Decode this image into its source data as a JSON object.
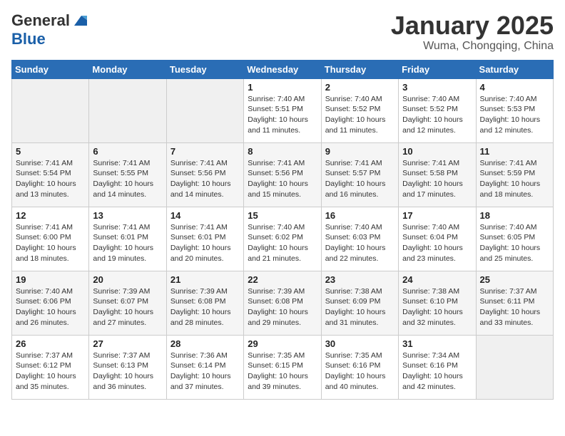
{
  "logo": {
    "general": "General",
    "blue": "Blue"
  },
  "title": "January 2025",
  "location": "Wuma, Chongqing, China",
  "days_of_week": [
    "Sunday",
    "Monday",
    "Tuesday",
    "Wednesday",
    "Thursday",
    "Friday",
    "Saturday"
  ],
  "weeks": [
    [
      {
        "day": "",
        "info": ""
      },
      {
        "day": "",
        "info": ""
      },
      {
        "day": "",
        "info": ""
      },
      {
        "day": "1",
        "info": "Sunrise: 7:40 AM\nSunset: 5:51 PM\nDaylight: 10 hours\nand 11 minutes."
      },
      {
        "day": "2",
        "info": "Sunrise: 7:40 AM\nSunset: 5:52 PM\nDaylight: 10 hours\nand 11 minutes."
      },
      {
        "day": "3",
        "info": "Sunrise: 7:40 AM\nSunset: 5:52 PM\nDaylight: 10 hours\nand 12 minutes."
      },
      {
        "day": "4",
        "info": "Sunrise: 7:40 AM\nSunset: 5:53 PM\nDaylight: 10 hours\nand 12 minutes."
      }
    ],
    [
      {
        "day": "5",
        "info": "Sunrise: 7:41 AM\nSunset: 5:54 PM\nDaylight: 10 hours\nand 13 minutes."
      },
      {
        "day": "6",
        "info": "Sunrise: 7:41 AM\nSunset: 5:55 PM\nDaylight: 10 hours\nand 14 minutes."
      },
      {
        "day": "7",
        "info": "Sunrise: 7:41 AM\nSunset: 5:56 PM\nDaylight: 10 hours\nand 14 minutes."
      },
      {
        "day": "8",
        "info": "Sunrise: 7:41 AM\nSunset: 5:56 PM\nDaylight: 10 hours\nand 15 minutes."
      },
      {
        "day": "9",
        "info": "Sunrise: 7:41 AM\nSunset: 5:57 PM\nDaylight: 10 hours\nand 16 minutes."
      },
      {
        "day": "10",
        "info": "Sunrise: 7:41 AM\nSunset: 5:58 PM\nDaylight: 10 hours\nand 17 minutes."
      },
      {
        "day": "11",
        "info": "Sunrise: 7:41 AM\nSunset: 5:59 PM\nDaylight: 10 hours\nand 18 minutes."
      }
    ],
    [
      {
        "day": "12",
        "info": "Sunrise: 7:41 AM\nSunset: 6:00 PM\nDaylight: 10 hours\nand 18 minutes."
      },
      {
        "day": "13",
        "info": "Sunrise: 7:41 AM\nSunset: 6:01 PM\nDaylight: 10 hours\nand 19 minutes."
      },
      {
        "day": "14",
        "info": "Sunrise: 7:41 AM\nSunset: 6:01 PM\nDaylight: 10 hours\nand 20 minutes."
      },
      {
        "day": "15",
        "info": "Sunrise: 7:40 AM\nSunset: 6:02 PM\nDaylight: 10 hours\nand 21 minutes."
      },
      {
        "day": "16",
        "info": "Sunrise: 7:40 AM\nSunset: 6:03 PM\nDaylight: 10 hours\nand 22 minutes."
      },
      {
        "day": "17",
        "info": "Sunrise: 7:40 AM\nSunset: 6:04 PM\nDaylight: 10 hours\nand 23 minutes."
      },
      {
        "day": "18",
        "info": "Sunrise: 7:40 AM\nSunset: 6:05 PM\nDaylight: 10 hours\nand 25 minutes."
      }
    ],
    [
      {
        "day": "19",
        "info": "Sunrise: 7:40 AM\nSunset: 6:06 PM\nDaylight: 10 hours\nand 26 minutes."
      },
      {
        "day": "20",
        "info": "Sunrise: 7:39 AM\nSunset: 6:07 PM\nDaylight: 10 hours\nand 27 minutes."
      },
      {
        "day": "21",
        "info": "Sunrise: 7:39 AM\nSunset: 6:08 PM\nDaylight: 10 hours\nand 28 minutes."
      },
      {
        "day": "22",
        "info": "Sunrise: 7:39 AM\nSunset: 6:08 PM\nDaylight: 10 hours\nand 29 minutes."
      },
      {
        "day": "23",
        "info": "Sunrise: 7:38 AM\nSunset: 6:09 PM\nDaylight: 10 hours\nand 31 minutes."
      },
      {
        "day": "24",
        "info": "Sunrise: 7:38 AM\nSunset: 6:10 PM\nDaylight: 10 hours\nand 32 minutes."
      },
      {
        "day": "25",
        "info": "Sunrise: 7:37 AM\nSunset: 6:11 PM\nDaylight: 10 hours\nand 33 minutes."
      }
    ],
    [
      {
        "day": "26",
        "info": "Sunrise: 7:37 AM\nSunset: 6:12 PM\nDaylight: 10 hours\nand 35 minutes."
      },
      {
        "day": "27",
        "info": "Sunrise: 7:37 AM\nSunset: 6:13 PM\nDaylight: 10 hours\nand 36 minutes."
      },
      {
        "day": "28",
        "info": "Sunrise: 7:36 AM\nSunset: 6:14 PM\nDaylight: 10 hours\nand 37 minutes."
      },
      {
        "day": "29",
        "info": "Sunrise: 7:35 AM\nSunset: 6:15 PM\nDaylight: 10 hours\nand 39 minutes."
      },
      {
        "day": "30",
        "info": "Sunrise: 7:35 AM\nSunset: 6:16 PM\nDaylight: 10 hours\nand 40 minutes."
      },
      {
        "day": "31",
        "info": "Sunrise: 7:34 AM\nSunset: 6:16 PM\nDaylight: 10 hours\nand 42 minutes."
      },
      {
        "day": "",
        "info": ""
      }
    ]
  ],
  "empty_days": [
    0,
    1,
    2
  ],
  "last_empty": [
    6
  ]
}
